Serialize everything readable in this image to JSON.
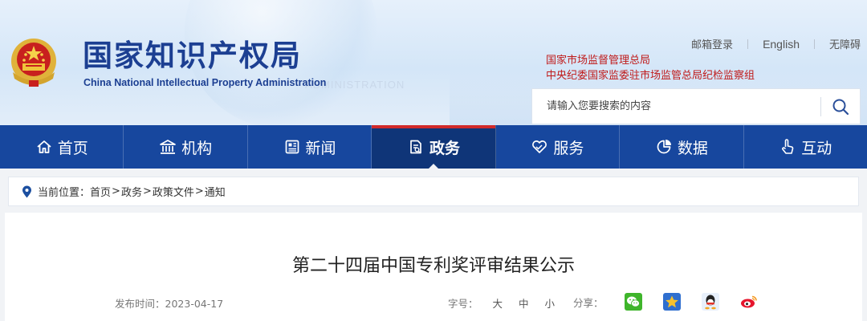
{
  "header": {
    "logo_cn": "国家知识产权局",
    "logo_en": "China National Intellectual Property Administration",
    "watermark": "ADMINISTRATION",
    "top_links": [
      "邮箱登录",
      "English",
      "无障碍"
    ],
    "agency_links": [
      "国家市场监督管理总局",
      "中央纪委国家监委驻市场监管总局纪检监察组"
    ],
    "search_placeholder": "请输入您要搜索的内容"
  },
  "nav": {
    "active_index": 3,
    "items": [
      {
        "label": "首页",
        "icon": "home-icon"
      },
      {
        "label": "机构",
        "icon": "institution-icon"
      },
      {
        "label": "新闻",
        "icon": "newspaper-icon"
      },
      {
        "label": "政务",
        "icon": "document-icon"
      },
      {
        "label": "服务",
        "icon": "heart-hand-icon"
      },
      {
        "label": "数据",
        "icon": "pie-chart-icon"
      },
      {
        "label": "互动",
        "icon": "hand-pointer-icon"
      }
    ]
  },
  "breadcrumb": {
    "prefix": "当前位置：",
    "items": [
      "首页",
      "政务",
      "政策文件",
      "通知"
    ],
    "separator": ">"
  },
  "article": {
    "title": "第二十四届中国专利奖评审结果公示",
    "publish_label": "发布时间：",
    "publish_date": "2023-04-17",
    "font_size_label": "字号：",
    "font_sizes": [
      "大",
      "中",
      "小"
    ],
    "share_label": "分享：",
    "share_targets": [
      "wechat-icon",
      "qzone-icon",
      "qq-icon",
      "weibo-icon"
    ]
  },
  "colors": {
    "nav_bg": "#17479e",
    "nav_active_bg": "#0f3578",
    "accent_red": "#d12a2a",
    "logo_blue": "#1c3f92",
    "agency_red": "#c01b1b"
  }
}
